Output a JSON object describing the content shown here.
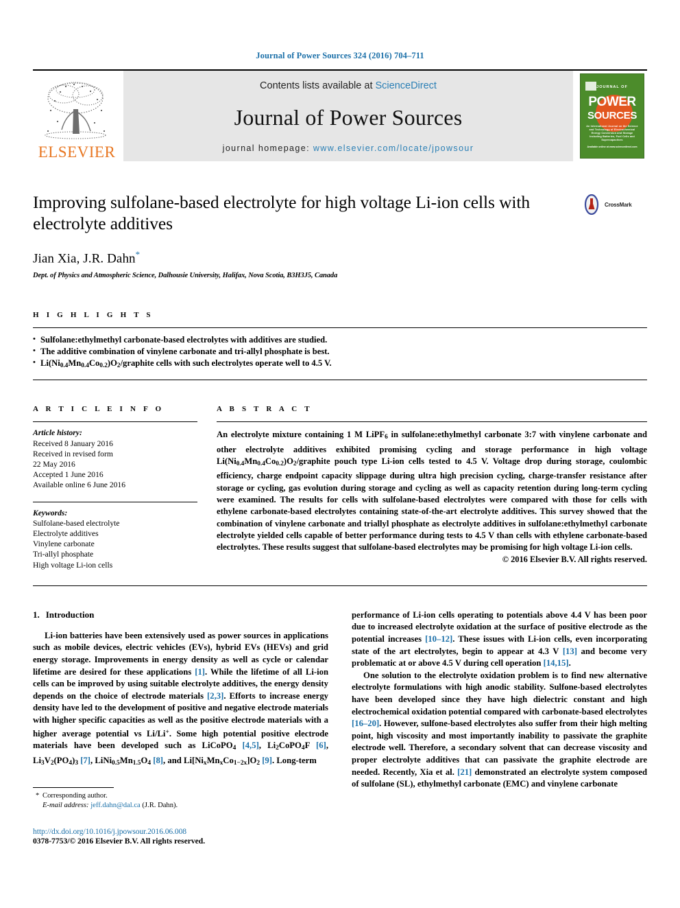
{
  "running_head": "Journal of Power Sources 324 (2016) 704–711",
  "masthead": {
    "elsevier_label": "ELSEVIER",
    "contents_prefix": "Contents lists available at ",
    "contents_link": "ScienceDirect",
    "journal_name": "Journal of Power Sources",
    "homepage_prefix": "journal homepage: ",
    "homepage_url": "www.elsevier.com/locate/jpowsour",
    "cover": {
      "line1": "JOURNAL OF",
      "line2": "POWER",
      "line3": "SOURCES",
      "subtitle": "An International Journal on the Science and Technology of Electrochemical Energy Conversion and Storage Including Batteries, Fuel Cells and Supercapacitors",
      "imprint": "Available online at\nwww.sciencedirect.com"
    }
  },
  "article": {
    "title": "Improving sulfolane-based electrolyte for high voltage Li-ion cells with electrolyte additives",
    "authors": "Jian Xia, J.R. Dahn",
    "corresponding_marker": "*",
    "affiliation": "Dept. of Physics and Atmospheric Science, Dalhousie University, Halifax, Nova Scotia, B3H3J5, Canada",
    "crossmark_label": "CrossMark"
  },
  "highlights": {
    "label": "H I G H L I G H T S",
    "items": [
      "Sulfolane:ethylmethyl carbonate-based electrolytes with additives are studied.",
      "The additive combination of vinylene carbonate and tri-allyl phosphate is best.",
      "Li(Ni0.4Mn0.4Co0.2)O2/graphite cells with such electrolytes operate well to 4.5 V."
    ],
    "item3_parts": {
      "pre": "Li(Ni",
      "s1": "0.4",
      "mid1": "Mn",
      "s2": "0.4",
      "mid2": "Co",
      "s3": "0.2",
      "mid3": ")O",
      "s4": "2",
      "post": "/graphite cells with such electrolytes operate well to 4.5 V."
    }
  },
  "article_info": {
    "label": "A R T I C L E   I N F O",
    "history_head": "Article history:",
    "history": [
      "Received 8 January 2016",
      "Received in revised form",
      "22 May 2016",
      "Accepted 1 June 2016",
      "Available online 6 June 2016"
    ],
    "keywords_head": "Keywords:",
    "keywords": [
      "Sulfolane-based electrolyte",
      "Electrolyte additives",
      "Vinylene carbonate",
      "Tri-allyl phosphate",
      "High voltage Li-ion cells"
    ]
  },
  "abstract": {
    "label": "A B S T R A C T",
    "p1_a": "An electrolyte mixture containing 1 M LiPF",
    "p1_sub1": "6",
    "p1_b": " in sulfolane:ethylmethyl carbonate 3:7 with vinylene carbonate and other electrolyte additives exhibited promising cycling and storage performance in high voltage Li(Ni",
    "p1_sub2": "0.4",
    "p1_c": "Mn",
    "p1_sub3": "0.4",
    "p1_d": "Co",
    "p1_sub4": "0.2",
    "p1_e": ")O",
    "p1_sub5": "2",
    "p1_f": "/graphite pouch type Li-ion cells tested to 4.5 V. Voltage drop during storage, coulombic efficiency, charge endpoint capacity slippage during ultra high precision cycling, charge-transfer resistance after storage or cycling, gas evolution during storage and cycling as well as capacity retention during long-term cycling were examined. The results for cells with sulfolane-based electrolytes were compared with those for cells with ethylene carbonate-based electrolytes containing state-of-the-art electrolyte additives. This survey showed that the combination of vinylene carbonate and triallyl phosphate as electrolyte additives in sulfolane:ethylmethyl carbonate electrolyte yielded cells capable of better performance during tests to 4.5 V than cells with ethylene carbonate-based electrolytes. These results suggest that sulfolane-based electrolytes may be promising for high voltage Li-ion cells.",
    "copyright": "© 2016 Elsevier B.V. All rights reserved."
  },
  "introduction": {
    "number": "1.",
    "heading": "Introduction",
    "left_p1_a": "Li-ion batteries have been extensively used as power sources in applications such as mobile devices, electric vehicles (EVs), hybrid EVs (HEVs) and grid energy storage. Improvements in energy density as well as cycle or calendar lifetime are desired for these applications ",
    "left_ref1": "[1]",
    "left_p1_b": ". While the lifetime of all Li-ion cells can be improved by using suitable electrolyte additives, the energy density depends on the choice of electrode materials ",
    "left_ref2": "[2,3]",
    "left_p1_c": ". Efforts to increase energy density have led to the development of positive and negative electrode materials with higher specific capacities as well as the positive electrode materials with a higher average potential vs Li/Li",
    "left_sup1": "+",
    "left_p1_d": ". Some high potential positive electrode materials have been developed such as LiCoPO",
    "left_sub1": "4",
    "left_ref3": "[4,5]",
    "left_p1_e": ", Li",
    "left_sub2": "2",
    "left_p1_f": "CoPO",
    "left_sub3": "4",
    "left_p1_g": "F ",
    "left_ref4": "[6]",
    "left_p1_h": ", Li",
    "left_sub4": "3",
    "left_p1_i": "V",
    "left_sub5": "2",
    "left_p1_j": "(PO",
    "left_sub6": "4",
    "left_p1_k": ")",
    "left_sub7": "3",
    "left_ref5": "[7]",
    "left_p1_l": ", LiNi",
    "left_sub8": "0.5",
    "left_p1_m": "Mn",
    "left_sub9": "1.5",
    "left_p1_n": "O",
    "left_sub10": "4",
    "left_ref6": "[8]",
    "left_p1_o": ", and Li[Ni",
    "left_subx1": "x",
    "left_p1_p": "Mn",
    "left_subx2": "x",
    "left_p1_q": "Co",
    "left_subx3": "1−2x",
    "left_p1_r": "]O",
    "left_sub11": "2",
    "left_ref7": "[9]",
    "left_p1_s": ". Long-term",
    "right_p1_a": "performance of Li-ion cells operating to potentials above 4.4 V has been poor due to increased electrolyte oxidation at the surface of positive electrode as the potential increases ",
    "right_ref1": "[10–12]",
    "right_p1_b": ". These issues with Li-ion cells, even incorporating state of the art electrolytes, begin to appear at 4.3 V ",
    "right_ref2": "[13]",
    "right_p1_c": " and become very problematic at or above 4.5 V during cell operation ",
    "right_ref3": "[14,15]",
    "right_p1_d": ".",
    "right_p2_a": "One solution to the electrolyte oxidation problem is to find new alternative electrolyte formulations with high anodic stability. Sulfone-based electrolytes have been developed since they have high dielectric constant and high electrochemical oxidation potential compared with carbonate-based electrolytes ",
    "right_ref4": "[16–20]",
    "right_p2_b": ". However, sulfone-based electrolytes also suffer from their high melting point, high viscosity and most importantly inability to passivate the graphite electrode well. Therefore, a secondary solvent that can decrease viscosity and proper electrolyte additives that can passivate the graphite electrode are needed. Recently, Xia et al. ",
    "right_ref5": "[21]",
    "right_p2_c": " demonstrated an electrolyte system composed of sulfolane (SL), ethylmethyl carbonate (EMC) and vinylene carbonate"
  },
  "footer": {
    "corresponding_marker": "*",
    "corresponding_label": "Corresponding author.",
    "email_label": "E-mail address:",
    "email": "jeff.dahn@dal.ca",
    "email_owner": "(J.R. Dahn).",
    "doi": "http://dx.doi.org/10.1016/j.jpowsour.2016.06.008",
    "issn": "0378-7753/© 2016 Elsevier B.V. All rights reserved."
  },
  "colors": {
    "link": "#1a6fa8",
    "elsevier_orange": "#E87722",
    "cover_green": "#4c8c2b",
    "cover_orange": "#e2561f",
    "masthead_gray": "#e6e6e6"
  }
}
